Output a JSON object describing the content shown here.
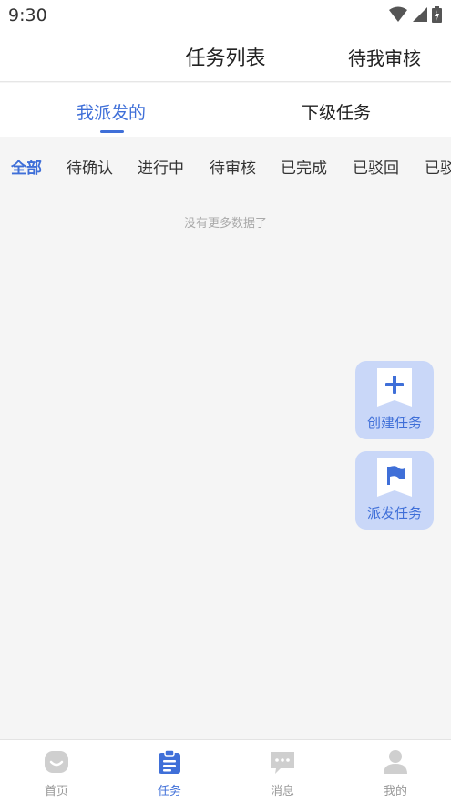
{
  "status_bar": {
    "time": "9:30"
  },
  "header": {
    "title": "任务列表",
    "right_action": "待我审核"
  },
  "tabs": [
    {
      "label": "我派发的",
      "active": true
    },
    {
      "label": "下级任务",
      "active": false
    }
  ],
  "filters": [
    {
      "label": "全部",
      "active": true
    },
    {
      "label": "待确认"
    },
    {
      "label": "进行中"
    },
    {
      "label": "待审核"
    },
    {
      "label": "已完成"
    },
    {
      "label": "已驳回"
    },
    {
      "label": "已驳"
    }
  ],
  "empty_state": {
    "text": "没有更多数据了"
  },
  "fabs": {
    "create": {
      "label": "创建任务",
      "icon": "plus-icon"
    },
    "dispatch": {
      "label": "派发任务",
      "icon": "flag-icon"
    }
  },
  "bottom_nav": [
    {
      "label": "首页",
      "icon": "home-icon"
    },
    {
      "label": "任务",
      "icon": "clipboard-icon",
      "active": true
    },
    {
      "label": "消息",
      "icon": "message-icon"
    },
    {
      "label": "我的",
      "icon": "person-icon"
    }
  ],
  "colors": {
    "accent": "#3f6fd8",
    "fab_bg": "#c9d7f8",
    "inactive_icon": "#cfcfcf"
  }
}
